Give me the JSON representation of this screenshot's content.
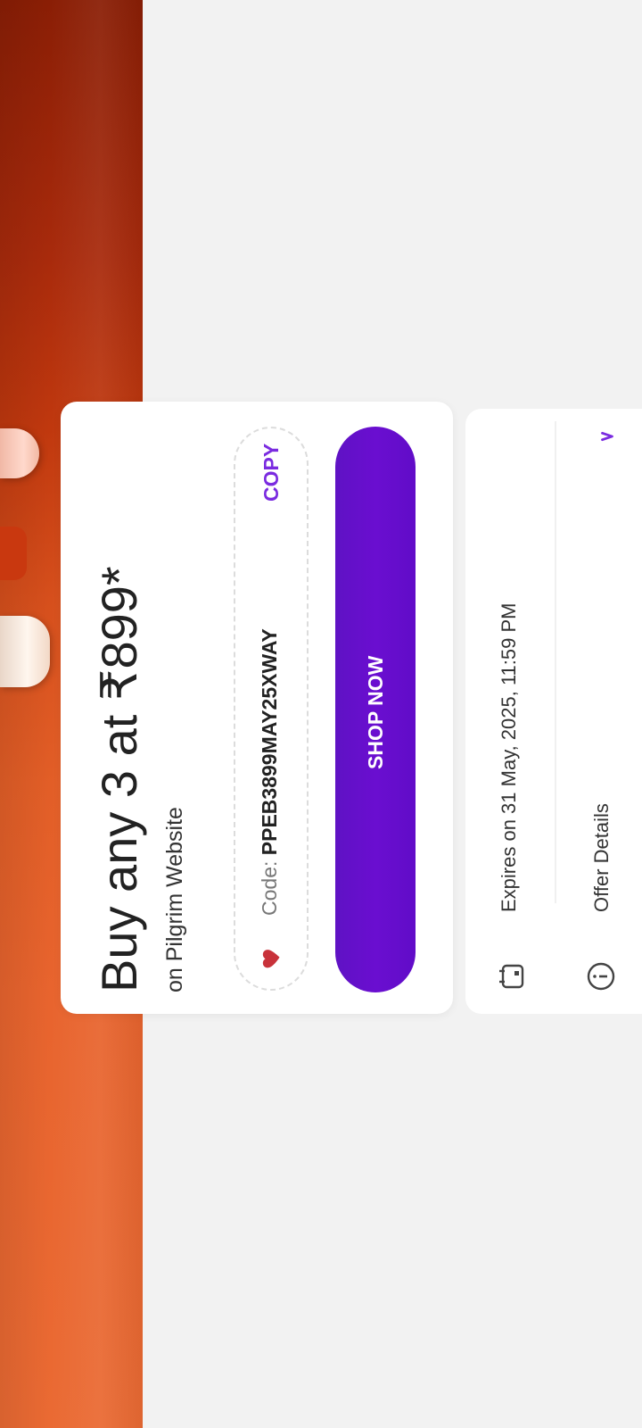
{
  "offer": {
    "title": "Buy any 3 at ₹899*",
    "subtitle": "on Pilgrim Website",
    "code_prefix": "Code: ",
    "code": "PPEB3899MAY25XWAY",
    "copy_label": "COPY",
    "shop_label": "SHOP NOW"
  },
  "details": {
    "expires": "Expires on 31 May, 2025, 11:59 PM",
    "offer_details_label": "Offer Details"
  },
  "colors": {
    "accent": "#6a0ed0",
    "copy": "#7a2be0",
    "hero": "#e8642e"
  }
}
